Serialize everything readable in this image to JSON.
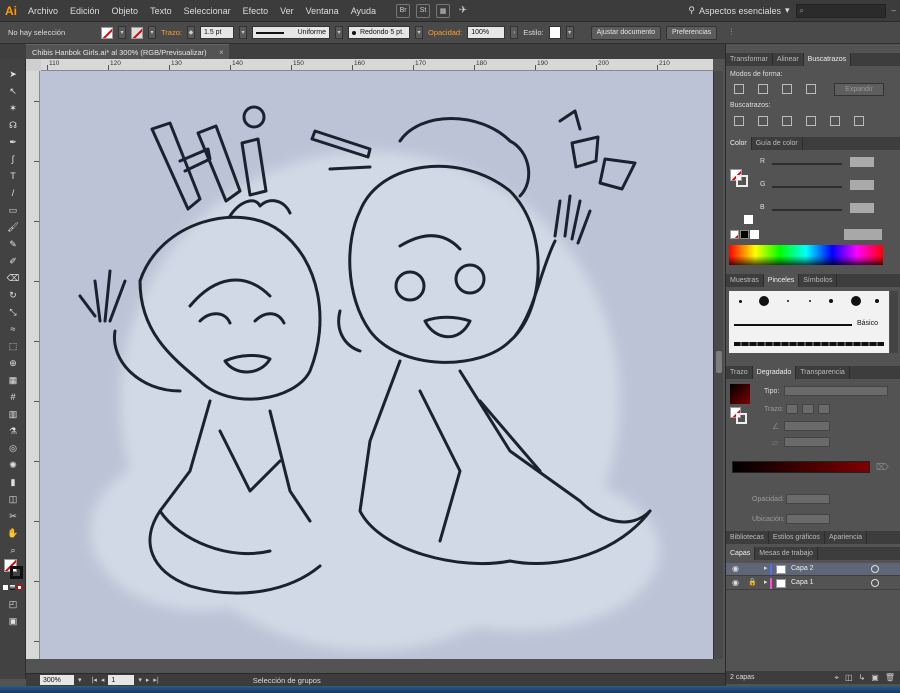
{
  "app": {
    "logo": "Ai"
  },
  "menu": [
    "Archivo",
    "Edición",
    "Objeto",
    "Texto",
    "Seleccionar",
    "Efecto",
    "Ver",
    "Ventana",
    "Ayuda"
  ],
  "menubar": {
    "bridge": "Br",
    "stock": "St",
    "workspace": "Aspectos esenciales",
    "search_placeholder": ""
  },
  "control": {
    "selection": "No hay selección",
    "stroke_label": "Trazo:",
    "stroke_value": "1.5 pt",
    "stroke_profile": "Uniforme",
    "brush": "Redondo 5 pt.",
    "opacity_label": "Opacidad:",
    "opacity_value": "100%",
    "style_label": "Estilo:",
    "doc_setup": "Ajustar documento",
    "preferences": "Preferencias"
  },
  "document": {
    "tab_title": "Chibis Hanbok Girls.ai* al 300% (RGB/Previsualizar)",
    "close": "×"
  },
  "ruler": {
    "top_ticks": [
      "110",
      "120",
      "130",
      "140",
      "150",
      "160",
      "170",
      "180",
      "190",
      "200",
      "210"
    ]
  },
  "status": {
    "zoom": "300%",
    "page": "1",
    "status_text": "Selección de grupos"
  },
  "panels": {
    "tabs_1": [
      "Transformar",
      "Alinear",
      "Buscatrazos"
    ],
    "shape_modes_label": "Modos de forma:",
    "expand_label": "Expandir",
    "pathfinders_label": "Buscatrazos:",
    "tabs_2": [
      "Color",
      "Guía de color"
    ],
    "color_channels": [
      "R",
      "G",
      "B"
    ],
    "tabs_3": [
      "Muestras",
      "Pinceles",
      "Símbolos"
    ],
    "brush_basic": "Básico",
    "tabs_4": [
      "Trazo",
      "Degradado",
      "Transparencia"
    ],
    "gradient_type_label": "Tipo:",
    "gradient_stroke_label": "Trazo:",
    "gradient_opacity_label": "Opacidad:",
    "gradient_location_label": "Ubicación:",
    "tabs_5": [
      "Bibliotecas",
      "Estilos gráficos",
      "Apariencia"
    ],
    "tabs_6": [
      "Capas",
      "Mesas de trabajo"
    ],
    "layers": [
      {
        "name": "Capa 2",
        "color": "#4f6dff",
        "selected": true
      },
      {
        "name": "Capa 1",
        "color": "#ff4fd8",
        "selected": false
      }
    ],
    "layers_count": "2 capas"
  },
  "icons": {
    "eye": "eye-icon",
    "lock": "lock-icon",
    "triangle": "disclosure-triangle-icon",
    "tools": [
      "selection-tool-icon",
      "direct-selection-tool-icon",
      "magic-wand-tool-icon",
      "lasso-tool-icon",
      "pen-tool-icon",
      "curvature-tool-icon",
      "type-tool-icon",
      "line-tool-icon",
      "rectangle-tool-icon",
      "paintbrush-tool-icon",
      "pencil-tool-icon",
      "blob-brush-tool-icon",
      "eraser-tool-icon",
      "rotate-tool-icon",
      "scale-tool-icon",
      "width-tool-icon",
      "free-transform-tool-icon",
      "shape-builder-tool-icon",
      "perspective-grid-tool-icon",
      "mesh-tool-icon",
      "gradient-tool-icon",
      "eyedropper-tool-icon",
      "blend-tool-icon",
      "symbol-sprayer-tool-icon",
      "column-graph-tool-icon",
      "artboard-tool-icon",
      "slice-tool-icon",
      "hand-tool-icon",
      "zoom-tool-icon"
    ]
  }
}
